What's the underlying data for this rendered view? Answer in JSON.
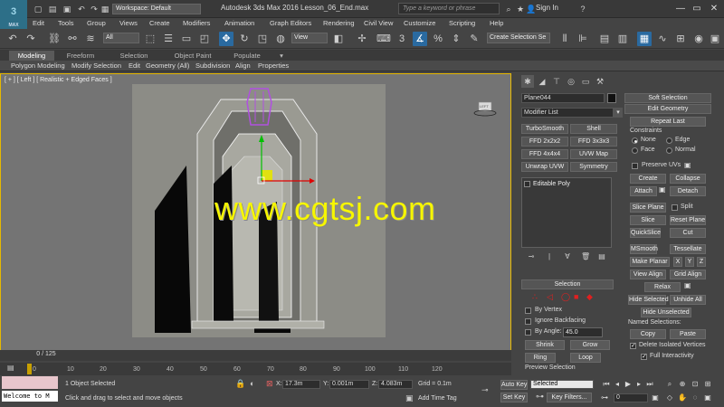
{
  "app": {
    "logo_text": "3",
    "logo_sub": "MAX",
    "title": "Autodesk 3ds Max 2016     Lesson_06_End.max",
    "workspace": "Workspace: Default",
    "search_placeholder": "Type a keyword or phrase",
    "signin": "Sign In"
  },
  "menu": [
    "Edit",
    "Tools",
    "Group",
    "Views",
    "Create",
    "Modifiers",
    "Animation",
    "Graph Editors",
    "Rendering",
    "Civil View",
    "Customize",
    "Scripting",
    "Help"
  ],
  "toolbar": {
    "selection_filter": "All",
    "ref_coord": "View",
    "named_selection": "Create Selection Se"
  },
  "ribbon": {
    "tabs": [
      "Modeling",
      "Freeform",
      "Selection",
      "Object Paint",
      "Populate"
    ],
    "active_tab": "Modeling",
    "subtabs": [
      "Polygon Modeling",
      "Modify Selection",
      "Edit",
      "Geometry (All)",
      "Subdivision",
      "Align",
      "Properties"
    ]
  },
  "viewport": {
    "label": "[ + ] [ Left ] [ Realistic + Edged Faces ]",
    "viewcube_label": "LEFT",
    "watermark": "www.cgtsj.com"
  },
  "command_panel": {
    "object_name": "Plane044",
    "modifier_list": "Modifier List",
    "modifier_buttons": [
      "TurboSmooth",
      "Shell",
      "FFD 2x2x2",
      "FFD 3x3x3",
      "FFD 4x4x4",
      "UVW Map",
      "Unwrap UVW",
      "Symmetry"
    ],
    "stack_item": "Editable Poly",
    "selection": {
      "title": "Selection",
      "by_vertex": "By Vertex",
      "ignore_backfacing": "Ignore Backfacing",
      "by_angle": "By Angle:",
      "angle_value": "45.0",
      "shrink": "Shrink",
      "grow": "Grow",
      "ring": "Ring",
      "loop": "Loop",
      "preview_selection": "Preview Selection"
    },
    "soft_selection": "Soft Selection",
    "edit_geometry": {
      "title": "Edit Geometry",
      "repeat_last": "Repeat Last",
      "constraints": "Constraints",
      "none": "None",
      "edge": "Edge",
      "face": "Face",
      "normal": "Normal",
      "preserve_uvs": "Preserve UVs",
      "create": "Create",
      "collapse": "Collapse",
      "attach": "Attach",
      "detach": "Detach",
      "slice_plane": "Slice Plane",
      "split": "Split",
      "slice": "Slice",
      "reset_plane": "Reset Plane",
      "quickslice": "QuickSlice",
      "cut": "Cut",
      "msmooth": "MSmooth",
      "tessellate": "Tessellate",
      "make_planar": "Make Planar",
      "x": "X",
      "y": "Y",
      "z": "Z",
      "view_align": "View Align",
      "grid_align": "Grid Align",
      "relax": "Relax",
      "hide_selected": "Hide Selected",
      "unhide_all": "Unhide All",
      "hide_unselected": "Hide Unselected",
      "named_selections": "Named Selections:",
      "copy": "Copy",
      "paste": "Paste",
      "delete_isolated": "Delete Isolated Vertices",
      "full_interactivity": "Full Interactivity"
    }
  },
  "timeline": {
    "counter": "0 / 125",
    "ticks": [
      "0",
      "10",
      "20",
      "30",
      "40",
      "50",
      "60",
      "70",
      "80",
      "90",
      "100",
      "110",
      "120"
    ]
  },
  "status": {
    "maxscript": "Welcome to M",
    "selected": "1 Object Selected",
    "prompt": "Click and drag to select and move objects",
    "x_label": "X:",
    "x_value": "17.3m",
    "y_label": "Y:",
    "y_value": "0.001m",
    "z_label": "Z:",
    "z_value": "4.083m",
    "grid": "Grid = 0.1m",
    "add_time_tag": "Add Time Tag",
    "auto_key": "Auto Key",
    "set_key": "Set Key",
    "key_mode": "Selected",
    "key_filters": "Key Filters...",
    "frame": "0"
  }
}
